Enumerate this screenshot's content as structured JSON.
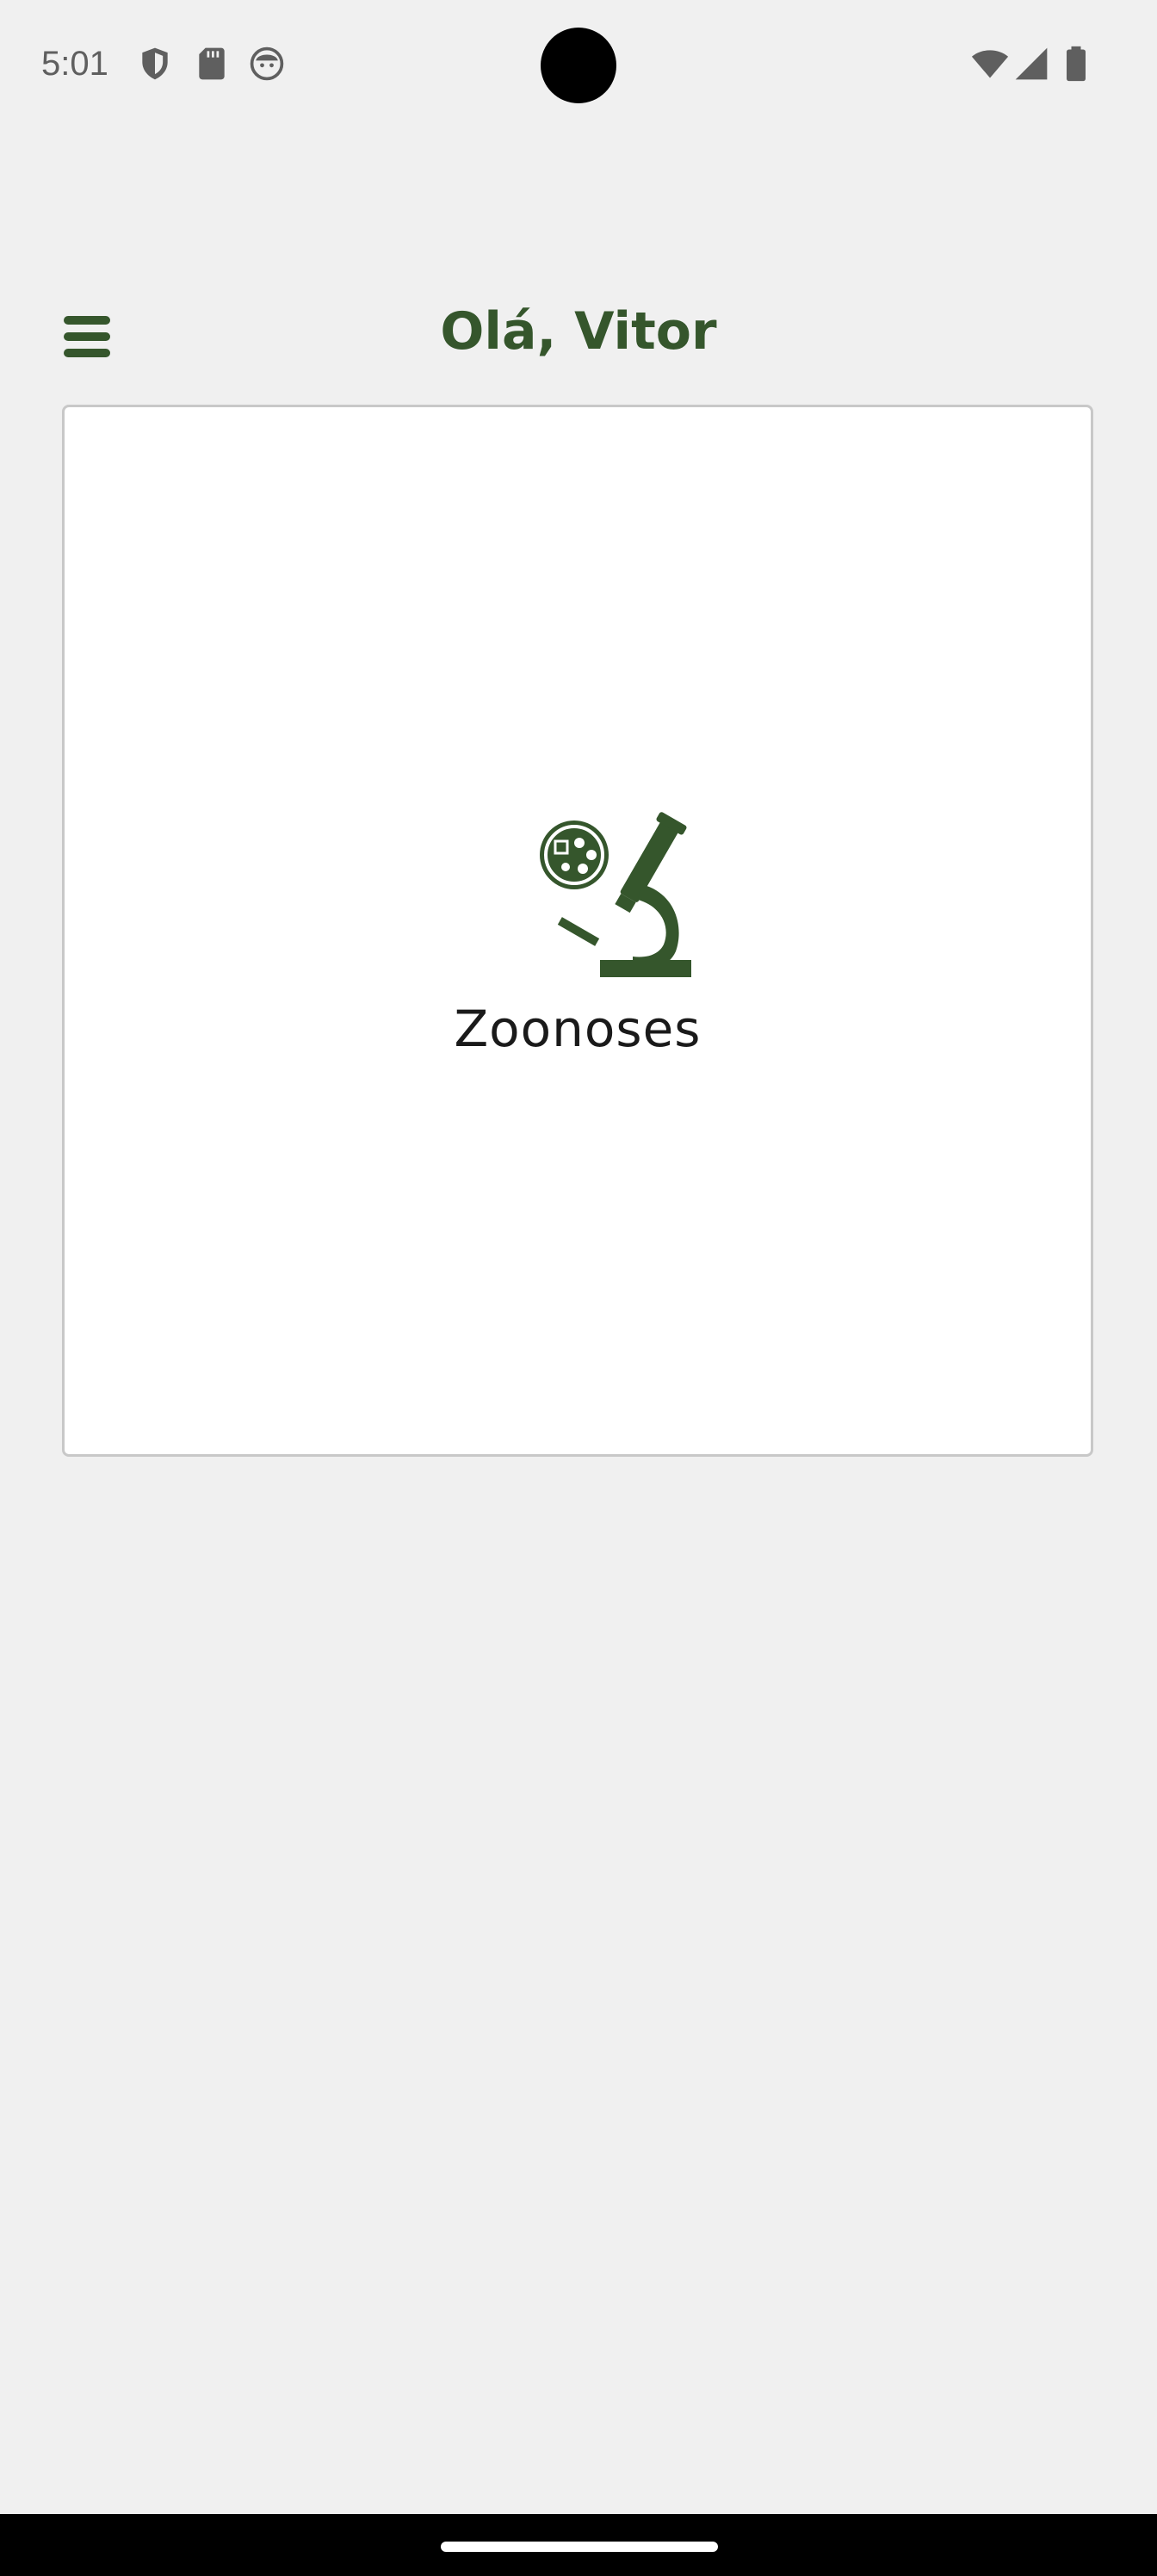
{
  "status_bar": {
    "time": "5:01",
    "left_icons": [
      "shield-icon",
      "sd-card-icon",
      "face-icon"
    ],
    "right_icons": [
      "wifi-icon",
      "signal-icon",
      "battery-icon"
    ]
  },
  "header": {
    "title": "Olá, Vitor",
    "menu_icon": "hamburger-menu-icon"
  },
  "cards": [
    {
      "label": "Zoonoses",
      "icon": "microscope-icon"
    }
  ],
  "colors": {
    "accent": "#35562c",
    "background": "#f0f0f0",
    "card": "#ffffff"
  }
}
